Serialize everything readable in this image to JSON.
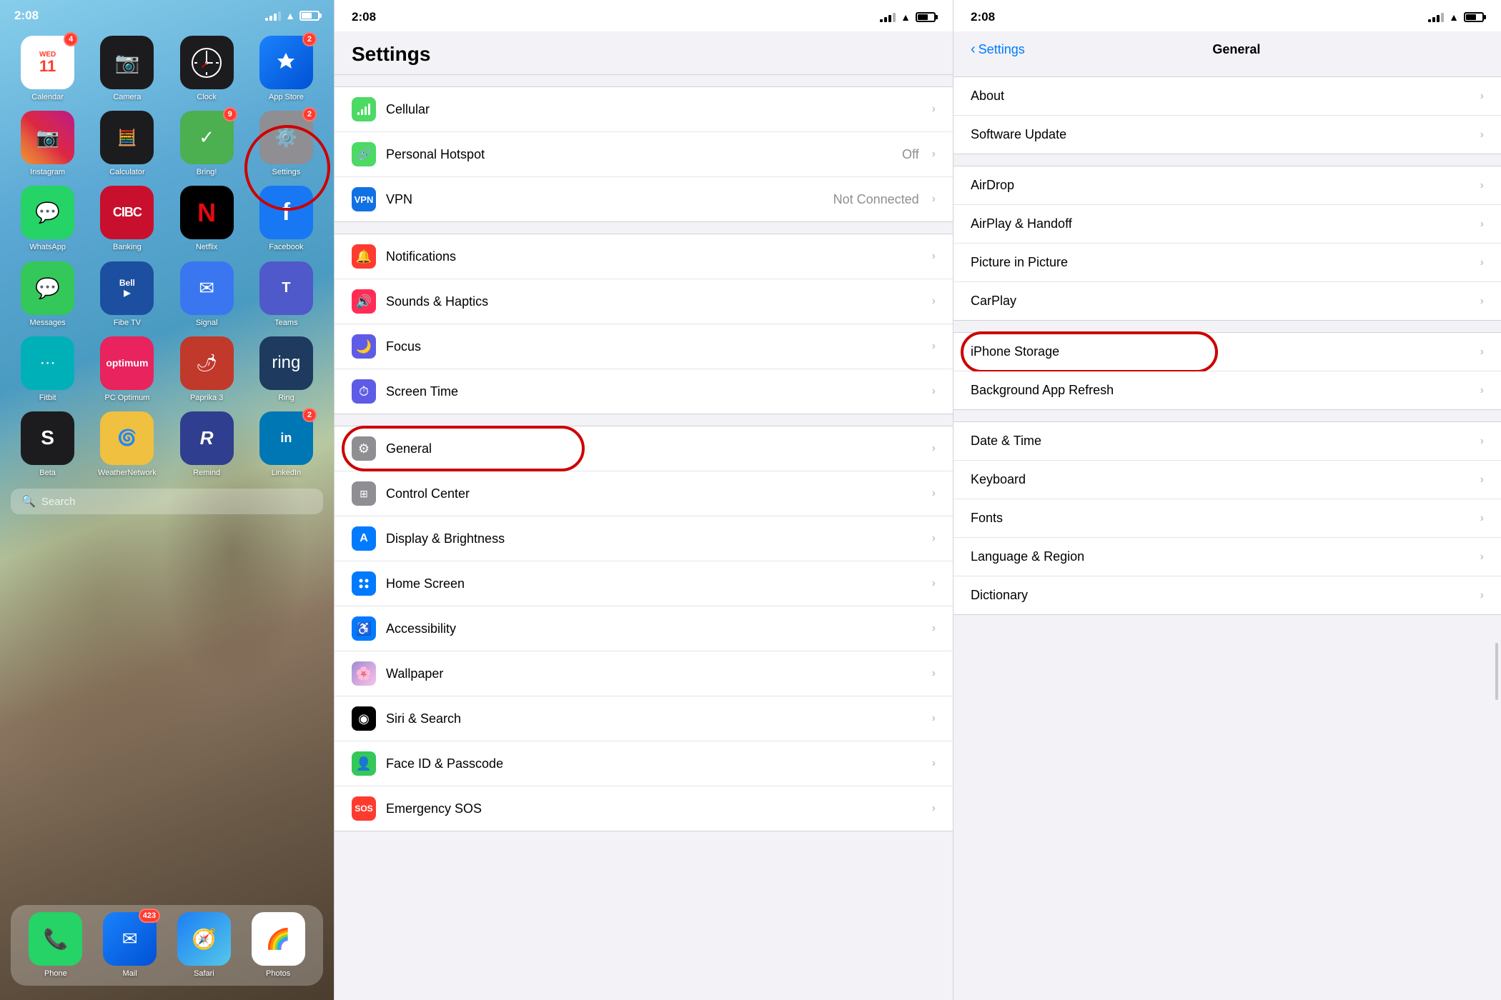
{
  "home": {
    "time": "2:08",
    "apps_row1": [
      {
        "id": "calendar",
        "label": "Calendar",
        "icon": "📅",
        "badge": "4",
        "colorClass": "app-calendar"
      },
      {
        "id": "camera",
        "label": "Camera",
        "icon": "📷",
        "badge": null,
        "colorClass": "app-camera"
      },
      {
        "id": "clock",
        "label": "Clock",
        "icon": "⏰",
        "badge": null,
        "colorClass": "app-clock"
      },
      {
        "id": "appstore",
        "label": "App Store",
        "icon": "⬇",
        "badge": "2",
        "colorClass": "app-appstore"
      }
    ],
    "apps_row2": [
      {
        "id": "instagram",
        "label": "Instagram",
        "icon": "📸",
        "badge": null,
        "colorClass": "app-instagram"
      },
      {
        "id": "calculator",
        "label": "Calculator",
        "icon": "🧮",
        "badge": null,
        "colorClass": "app-calculator"
      },
      {
        "id": "bring",
        "label": "Bring!",
        "icon": "✓",
        "badge": "9",
        "colorClass": "app-bring"
      },
      {
        "id": "settings",
        "label": "Settings",
        "icon": "⚙️",
        "badge": "2",
        "colorClass": "app-settings"
      }
    ],
    "apps_row3": [
      {
        "id": "whatsapp",
        "label": "WhatsApp",
        "icon": "💬",
        "badge": null,
        "colorClass": "app-whatsapp"
      },
      {
        "id": "banking",
        "label": "Banking",
        "icon": "🏦",
        "badge": null,
        "colorClass": "app-banking"
      },
      {
        "id": "netflix",
        "label": "Netflix",
        "icon": "N",
        "badge": null,
        "colorClass": "app-netflix"
      },
      {
        "id": "facebook",
        "label": "Facebook",
        "icon": "f",
        "badge": null,
        "colorClass": "app-facebook"
      }
    ],
    "apps_row4": [
      {
        "id": "messages",
        "label": "Messages",
        "icon": "💬",
        "badge": null,
        "colorClass": "app-messages"
      },
      {
        "id": "belltv",
        "label": "Fibe TV",
        "icon": "▶",
        "badge": null,
        "colorClass": "app-belltv"
      },
      {
        "id": "signal",
        "label": "Signal",
        "icon": "✉",
        "badge": null,
        "colorClass": "app-signal"
      },
      {
        "id": "teams",
        "label": "Teams",
        "icon": "T",
        "badge": null,
        "colorClass": "app-teams"
      }
    ],
    "apps_row5": [
      {
        "id": "fitbit",
        "label": "Fitbit",
        "icon": "⋯",
        "badge": null,
        "colorClass": "app-fitbit"
      },
      {
        "id": "pcoptimum",
        "label": "PC Optimum",
        "icon": "♦",
        "badge": null,
        "colorClass": "app-pcoptimum"
      },
      {
        "id": "paprika",
        "label": "Paprika 3",
        "icon": "🌶",
        "badge": null,
        "colorClass": "app-paprika"
      },
      {
        "id": "ring",
        "label": "Ring",
        "icon": "🔔",
        "badge": null,
        "colorClass": "app-ring"
      }
    ],
    "apps_row6": [
      {
        "id": "beta",
        "label": "Beta",
        "icon": "S",
        "badge": null,
        "colorClass": "app-beta"
      },
      {
        "id": "weather",
        "label": "WeatherNetwork",
        "icon": "🌀",
        "badge": null,
        "colorClass": "app-weather"
      },
      {
        "id": "remind",
        "label": "Remind",
        "icon": "R",
        "badge": null,
        "colorClass": "app-remind"
      },
      {
        "id": "linkedin",
        "label": "LinkedIn",
        "icon": "in",
        "badge": "2",
        "colorClass": "app-linkedin"
      }
    ],
    "search_placeholder": "Search",
    "dock": [
      {
        "id": "phone",
        "label": "Phone",
        "icon": "📞",
        "colorClass": "app-whatsapp",
        "badge": null
      },
      {
        "id": "mail",
        "label": "Mail",
        "icon": "✉",
        "colorClass": "app-appstore",
        "badge": "423"
      },
      {
        "id": "safari",
        "label": "Safari",
        "icon": "🧭",
        "colorClass": null,
        "badge": null
      },
      {
        "id": "photos",
        "label": "Photos",
        "icon": "🌈",
        "colorClass": null,
        "badge": null
      }
    ]
  },
  "settings": {
    "time": "2:08",
    "title": "Settings",
    "sections": [
      {
        "rows": [
          {
            "id": "cellular",
            "label": "Cellular",
            "icon": "📶",
            "iconBg": "#4cd964",
            "value": null
          },
          {
            "id": "hotspot",
            "label": "Personal Hotspot",
            "iconBg": "#4cd964",
            "icon": "🔗",
            "value": "Off"
          },
          {
            "id": "vpn",
            "label": "VPN",
            "iconBg": "#1071e5",
            "icon": "🔒",
            "value": "Not Connected"
          }
        ]
      },
      {
        "rows": [
          {
            "id": "notifications",
            "label": "Notifications",
            "iconBg": "#ff3b30",
            "icon": "🔔",
            "value": null
          },
          {
            "id": "sounds",
            "label": "Sounds & Haptics",
            "iconBg": "#ff2d55",
            "icon": "🔊",
            "value": null
          },
          {
            "id": "focus",
            "label": "Focus",
            "iconBg": "#5e5ce6",
            "icon": "🌙",
            "value": null
          },
          {
            "id": "screentime",
            "label": "Screen Time",
            "iconBg": "#5e5ce6",
            "icon": "⏱",
            "value": null
          }
        ]
      },
      {
        "rows": [
          {
            "id": "general",
            "label": "General",
            "iconBg": "#8e8e93",
            "icon": "⚙",
            "value": null,
            "circled": true
          },
          {
            "id": "controlcenter",
            "label": "Control Center",
            "iconBg": "#8e8e93",
            "icon": "⊞",
            "value": null
          },
          {
            "id": "displaybrightness",
            "label": "Display & Brightness",
            "iconBg": "#007aff",
            "icon": "A",
            "value": null
          },
          {
            "id": "homescreen",
            "label": "Home Screen",
            "iconBg": "#007aff",
            "icon": "⋮⋮",
            "value": null
          },
          {
            "id": "accessibility",
            "label": "Accessibility",
            "iconBg": "#007aff",
            "icon": "♿",
            "value": null
          },
          {
            "id": "wallpaper",
            "label": "Wallpaper",
            "iconBg": "#8e8e93",
            "icon": "🌸",
            "value": null
          },
          {
            "id": "sirisearch",
            "label": "Siri & Search",
            "iconBg": "#000",
            "icon": "◉",
            "value": null
          },
          {
            "id": "faceid",
            "label": "Face ID & Passcode",
            "iconBg": "#34c759",
            "icon": "👤",
            "value": null
          },
          {
            "id": "emergencysos",
            "label": "Emergency SOS",
            "iconBg": "#ff3b30",
            "icon": "🆘",
            "value": null
          }
        ]
      }
    ]
  },
  "general": {
    "time": "2:08",
    "back_label": "Settings",
    "title": "General",
    "sections": [
      {
        "rows": [
          {
            "id": "about",
            "label": "About",
            "circled": false
          },
          {
            "id": "softwareupdate",
            "label": "Software Update",
            "circled": false
          }
        ]
      },
      {
        "rows": [
          {
            "id": "airdrop",
            "label": "AirDrop",
            "circled": false
          },
          {
            "id": "airplay",
            "label": "AirPlay & Handoff",
            "circled": false
          },
          {
            "id": "pip",
            "label": "Picture in Picture",
            "circled": false
          },
          {
            "id": "carplay",
            "label": "CarPlay",
            "circled": false
          }
        ]
      },
      {
        "rows": [
          {
            "id": "iphonestorage",
            "label": "iPhone Storage",
            "circled": true
          },
          {
            "id": "backgroundrefresh",
            "label": "Background App Refresh",
            "circled": false
          }
        ]
      },
      {
        "rows": [
          {
            "id": "datetime",
            "label": "Date & Time",
            "circled": false
          },
          {
            "id": "keyboard",
            "label": "Keyboard",
            "circled": false
          },
          {
            "id": "fonts",
            "label": "Fonts",
            "circled": false
          },
          {
            "id": "language",
            "label": "Language & Region",
            "circled": false
          },
          {
            "id": "dictionary",
            "label": "Dictionary",
            "circled": false
          }
        ]
      }
    ]
  },
  "icons": {
    "chevron": "›",
    "back_chevron": "‹",
    "search": "🔍",
    "wifi": "WiFi"
  }
}
